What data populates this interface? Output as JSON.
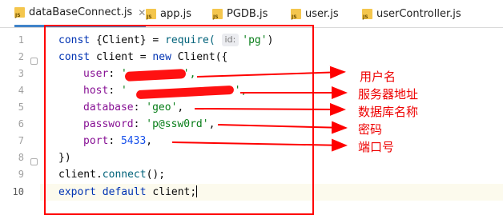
{
  "tabs": [
    {
      "label": "dataBaseConnect.js",
      "active": true
    },
    {
      "label": "app.js",
      "active": false
    },
    {
      "label": "PGDB.js",
      "active": false
    },
    {
      "label": "user.js",
      "active": false
    },
    {
      "label": "userController.js",
      "active": false
    }
  ],
  "line_numbers": [
    "1",
    "2",
    "3",
    "4",
    "5",
    "6",
    "7",
    "8",
    "9",
    "10"
  ],
  "code": {
    "l1": {
      "a": "const ",
      "b": "{Client}",
      "c": " = ",
      "d": "require(",
      "hint": "id:",
      "e": "'pg'",
      "f": ")"
    },
    "l2": {
      "a": "const ",
      "b": "client",
      "c": " = ",
      "d": "new ",
      "e": "Client({"
    },
    "l3": {
      "key": "user",
      "colon": ": ",
      "val_start": "'",
      "val_end": "',"
    },
    "l4": {
      "key": "host",
      "colon": ": ",
      "val_start": "'",
      "val_end": "',"
    },
    "l5": {
      "key": "database",
      "colon": ": ",
      "val": "'geo'",
      "comma": ","
    },
    "l6": {
      "key": "password",
      "colon": ": ",
      "val": "'p@ssw0rd'",
      "comma": ","
    },
    "l7": {
      "key": "port",
      "colon": ": ",
      "val": "5433",
      "comma": ","
    },
    "l8": "})",
    "l9": {
      "a": "client",
      "b": ".",
      "c": "connect",
      "d": "();"
    },
    "l10": {
      "a": "export ",
      "b": "default ",
      "c": "client;"
    }
  },
  "annotations": {
    "user": "用户名",
    "host": "服务器地址",
    "database": "数据库名称",
    "password": "密码",
    "port": "端口号"
  },
  "colors": {
    "keyword": "#0033b3",
    "string": "#067d17",
    "number": "#1750eb",
    "property": "#871094",
    "annotation_red": "#ff0000",
    "tab_underline": "#4083c9"
  }
}
